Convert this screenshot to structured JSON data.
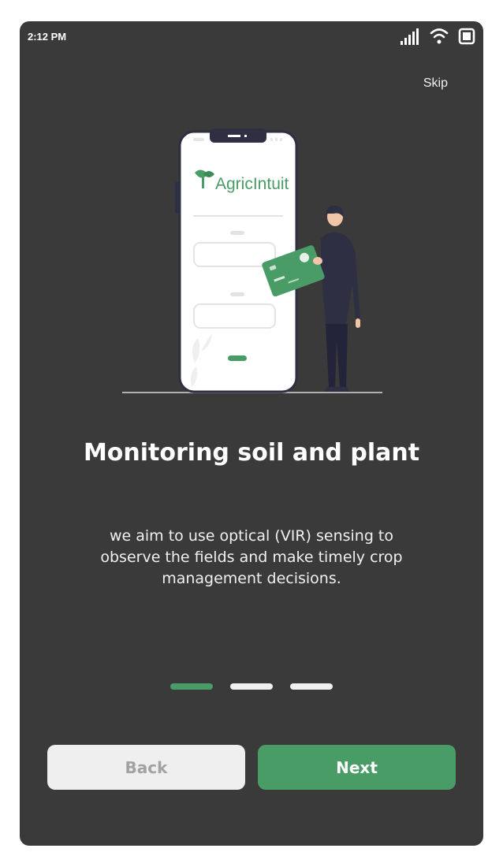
{
  "status_bar": {
    "time": "2:12 PM",
    "icons": [
      "signal-icon",
      "wifi-icon",
      "battery-icon"
    ]
  },
  "skip_label": "Skip",
  "illustration": {
    "brand_name": "AgricIntuit"
  },
  "onboarding": {
    "title": "Monitoring soil and plant",
    "description": "we aim to use optical (VIR) sensing to observe the fields and make timely crop management decisions.",
    "page_indicator": {
      "total": 3,
      "current": 1
    }
  },
  "buttons": {
    "back_label": "Back",
    "next_label": "Next"
  },
  "colors": {
    "background": "#3a3a3a",
    "accent": "#4a9c67",
    "back_button": "#efefef"
  }
}
